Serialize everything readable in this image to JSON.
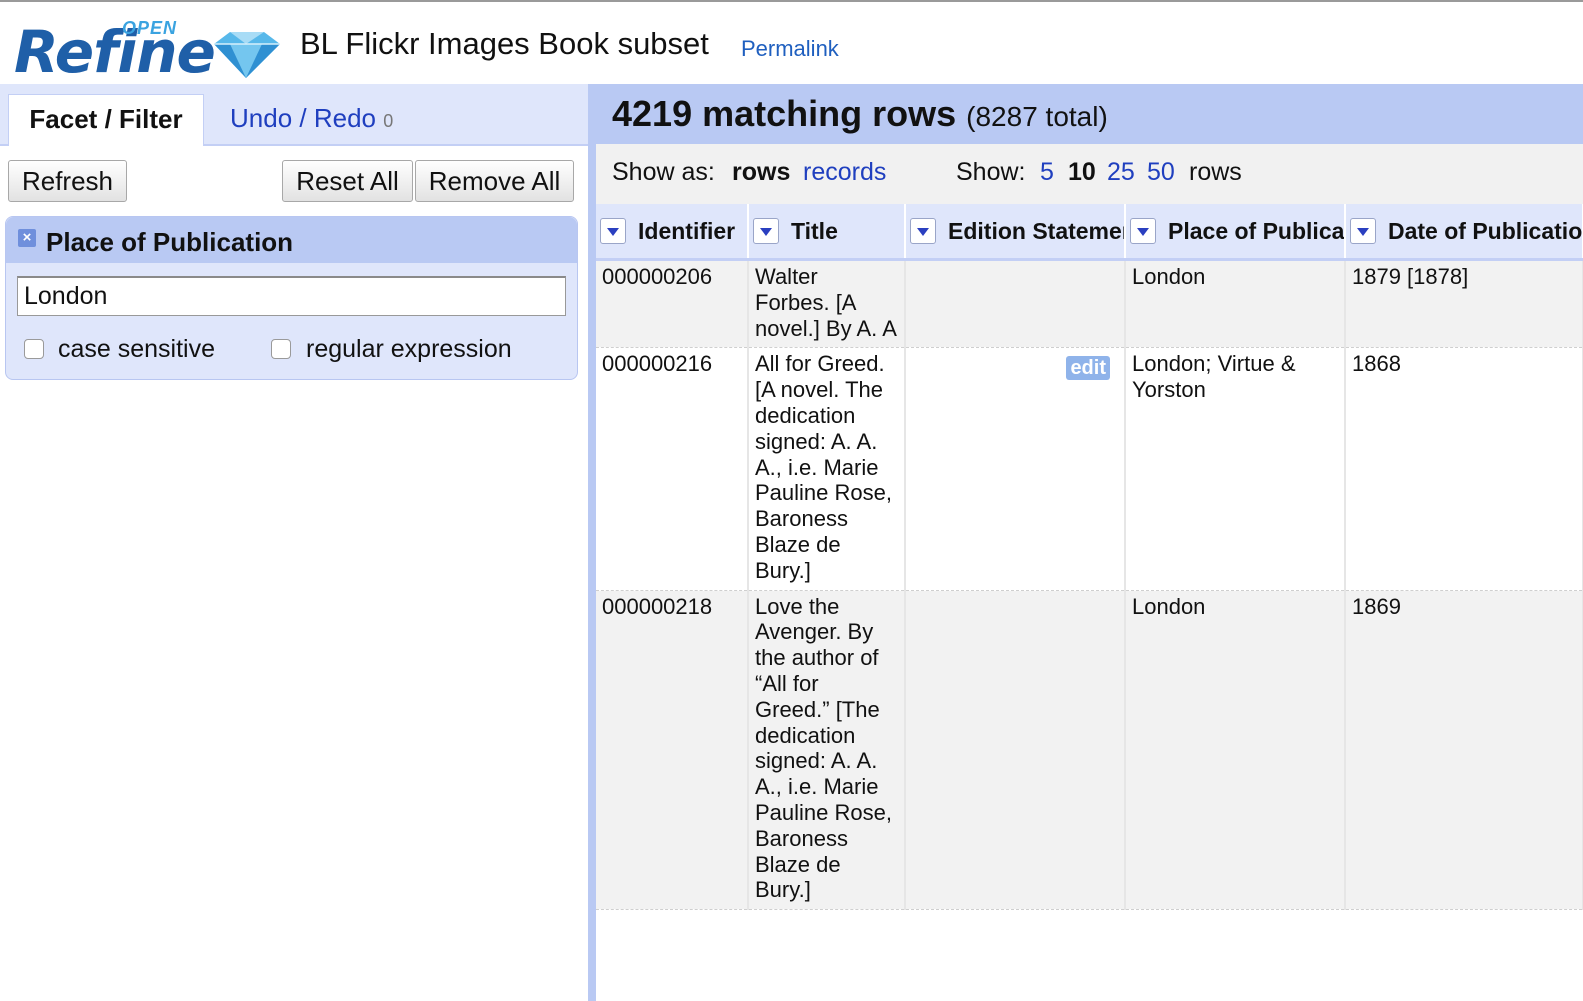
{
  "app": {
    "logo_text": "Refine",
    "logo_superscript": "OPEN",
    "project_title": "BL Flickr Images Book subset",
    "permalink": "Permalink"
  },
  "left_panel": {
    "tabs": {
      "facet_filter": "Facet / Filter",
      "undo_redo": "Undo / Redo",
      "undo_count": "0"
    },
    "buttons": {
      "refresh": "Refresh",
      "reset_all": "Reset All",
      "remove_all": "Remove All"
    },
    "facet": {
      "close_glyph": "×",
      "title": "Place of Publication",
      "value": "London",
      "case_sensitive_label": "case sensitive",
      "regex_label": "regular expression"
    }
  },
  "right_panel": {
    "matching": "4219 matching rows",
    "total": "(8287 total)",
    "show_as_label": "Show as:",
    "mode_rows": "rows",
    "mode_records": "records",
    "show_label": "Show:",
    "page_sizes": [
      "5",
      "10",
      "25",
      "50"
    ],
    "rows_label": "rows",
    "columns": [
      "Identifier",
      "Title",
      "Edition Statement",
      "Place of Publication",
      "Date of Publication"
    ],
    "rows": [
      {
        "identifier": "000000206",
        "title": "Walter Forbes. [A novel.] By A. A",
        "edition": "",
        "place": "London",
        "date": "1879 [1878]"
      },
      {
        "identifier": "000000216",
        "title": "All for Greed. [A novel. The dedication signed: A. A. A., i.e. Marie Pauline Rose, Baroness Blaze de Bury.]",
        "edition": "",
        "edit_badge": "edit",
        "place": "London; Virtue & Yorston",
        "date": "1868"
      },
      {
        "identifier": "000000218",
        "title": "Love the Avenger. By the author of “All for Greed.” [The dedication signed: A. A. A., i.e. Marie Pauline Rose, Baroness Blaze de Bury.]",
        "edition": "",
        "place": "London",
        "date": "1869"
      }
    ]
  },
  "colors": {
    "accent": "#b9c9f3",
    "light": "#dfe6fb",
    "link": "#1f3fbf",
    "logo": "#1f5fa8"
  }
}
